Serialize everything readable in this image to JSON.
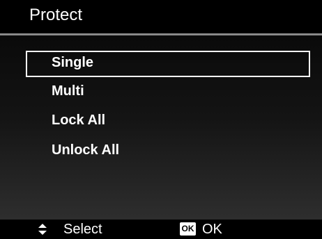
{
  "header": {
    "title": "Protect"
  },
  "menu": {
    "selected_index": 0,
    "items": [
      {
        "label": "Single"
      },
      {
        "label": "Multi"
      },
      {
        "label": "Lock All"
      },
      {
        "label": "Unlock All"
      }
    ]
  },
  "footer": {
    "select_icon": "up-down-arrows-icon",
    "select_label": "Select",
    "ok_icon_text": "OK",
    "ok_label": "OK"
  },
  "colors": {
    "background": "#000000",
    "highlight_border": "#ffffff",
    "title_rule": "#8a8a8a"
  }
}
